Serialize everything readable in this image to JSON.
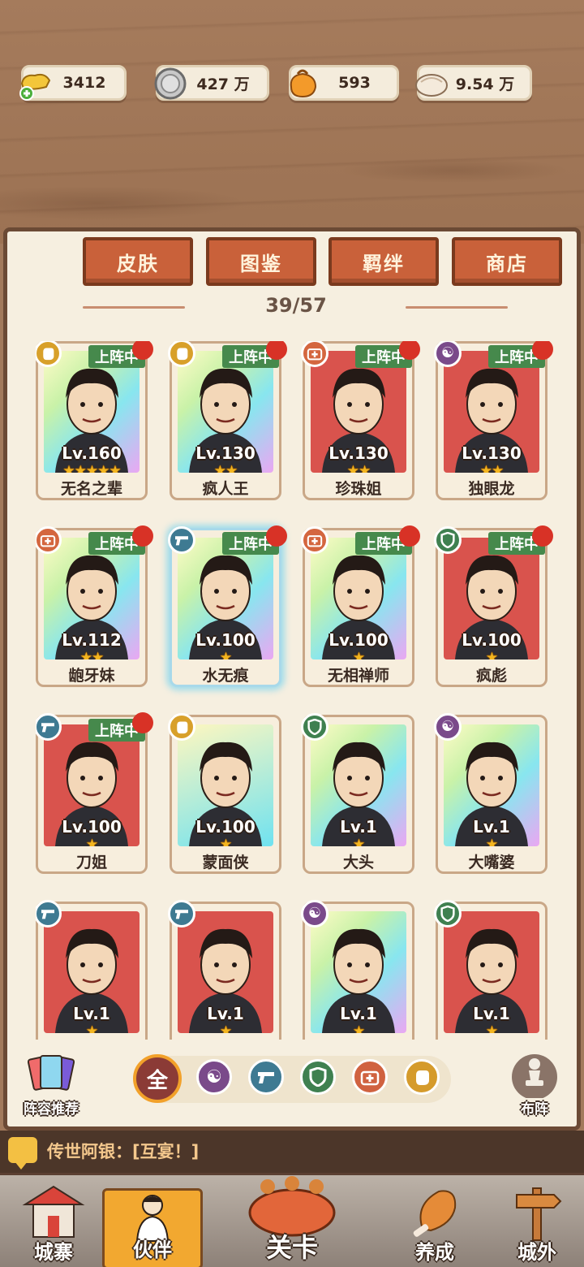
{
  "resources": [
    {
      "icon": "gold-ingot-plus-icon",
      "value": "3412"
    },
    {
      "icon": "silver-coin-icon",
      "value": "427 万"
    },
    {
      "icon": "orange-bag-icon",
      "value": "593"
    },
    {
      "icon": "meat-bun-icon",
      "value": "9.54 万"
    }
  ],
  "tabs": [
    "皮肤",
    "图鉴",
    "羁绊",
    "商店"
  ],
  "counter": "39/57",
  "onteam_label": "上阵中",
  "cards": [
    {
      "name": "无名之辈",
      "level": "Lv.160",
      "stars": "★★★★★",
      "type": "fist",
      "on_team": true,
      "bg": "rainbow"
    },
    {
      "name": "疯人王",
      "level": "Lv.130",
      "stars": "★★",
      "type": "fist",
      "on_team": true,
      "bg": "rainbow"
    },
    {
      "name": "珍珠姐",
      "level": "Lv.130",
      "stars": "★★",
      "type": "medic",
      "on_team": true,
      "bg": "red"
    },
    {
      "name": "独眼龙",
      "level": "Lv.130",
      "stars": "★★",
      "type": "yinyang",
      "on_team": true,
      "bg": "red"
    },
    {
      "name": "龅牙妹",
      "level": "Lv.112",
      "stars": "★★",
      "type": "medic",
      "on_team": true,
      "bg": "rainbow"
    },
    {
      "name": "水无痕",
      "level": "Lv.100",
      "stars": "★",
      "type": "gun",
      "on_team": true,
      "bg": "rainbow",
      "selected": true
    },
    {
      "name": "无相禅师",
      "level": "Lv.100",
      "stars": "★",
      "type": "medic",
      "on_team": true,
      "bg": "rainbow"
    },
    {
      "name": "疯彪",
      "level": "Lv.100",
      "stars": "★",
      "type": "shield",
      "on_team": true,
      "bg": "red"
    },
    {
      "name": "刀姐",
      "level": "Lv.100",
      "stars": "★",
      "type": "gun",
      "on_team": true,
      "bg": "red"
    },
    {
      "name": "蒙面侠",
      "level": "Lv.100",
      "stars": "★",
      "type": "fist",
      "on_team": false,
      "bg": "cyan"
    },
    {
      "name": "大头",
      "level": "Lv.1",
      "stars": "★",
      "type": "shield",
      "on_team": false,
      "bg": "rainbow"
    },
    {
      "name": "大嘴婆",
      "level": "Lv.1",
      "stars": "★",
      "type": "yinyang",
      "on_team": false,
      "bg": "rainbow"
    },
    {
      "name": "",
      "level": "Lv.1",
      "stars": "★",
      "type": "gun",
      "on_team": false,
      "bg": "red"
    },
    {
      "name": "",
      "level": "Lv.1",
      "stars": "★",
      "type": "gun",
      "on_team": false,
      "bg": "red"
    },
    {
      "name": "",
      "level": "Lv.1",
      "stars": "★",
      "type": "yinyang",
      "on_team": false,
      "bg": "rainbow"
    },
    {
      "name": "",
      "level": "Lv.1",
      "stars": "★",
      "type": "shield",
      "on_team": false,
      "bg": "red"
    }
  ],
  "filters": {
    "all_label": "全",
    "items": [
      "yinyang-icon",
      "gun-icon",
      "shield-icon",
      "medic-icon",
      "fist-icon"
    ]
  },
  "lineup_recommend_label": "阵容推荐",
  "formation_label": "布阵",
  "chat": {
    "text": "传世阿银：[互宴！]"
  },
  "nav": [
    "城寨",
    "伙伴",
    "关卡",
    "养成",
    "城外"
  ],
  "colors": {
    "accent": "#c9613a",
    "panel": "#f6efe0",
    "onteam_green": "#46894c",
    "star": "#f3b51f"
  }
}
